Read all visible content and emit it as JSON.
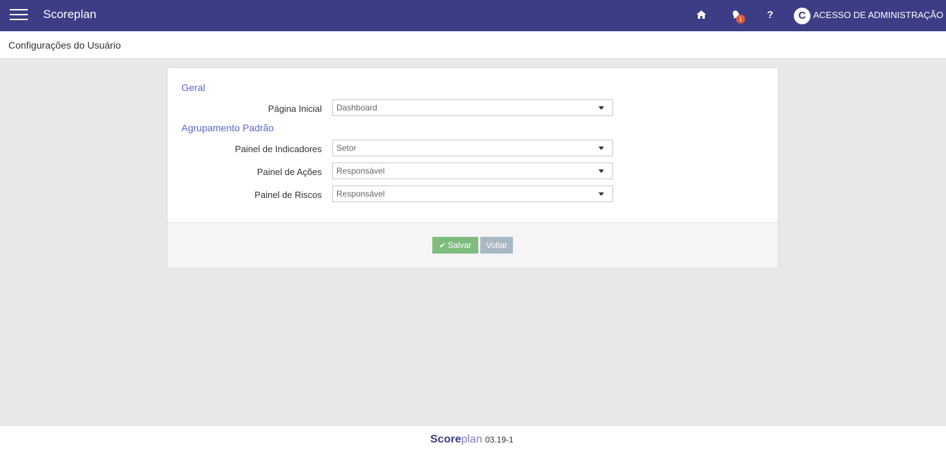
{
  "app": {
    "title": "Scoreplan"
  },
  "topbar": {
    "notification_count": "1",
    "help_label": "?",
    "avatar_initial": "C",
    "user_label": "ACESSO DE ADMINISTRAÇÃO",
    "background_color": "#3c3d84"
  },
  "page": {
    "title": "Configurações do Usuário"
  },
  "form": {
    "sections": [
      {
        "title": "Geral"
      },
      {
        "title": "Agrupamento Padrão"
      }
    ],
    "fields": [
      {
        "label": "Página Inicial",
        "value": "Dashboard"
      },
      {
        "label": "Painel de Indicadores",
        "value": "Setor"
      },
      {
        "label": "Painel de Ações",
        "value": "Responsável"
      },
      {
        "label": "Painel de Riscos",
        "value": "Responsável"
      }
    ],
    "buttons": {
      "save": "Salvar",
      "back": "Voltar"
    }
  },
  "footer": {
    "logo_part1": "Score",
    "logo_part2": "plan",
    "version": "03.19-1"
  }
}
